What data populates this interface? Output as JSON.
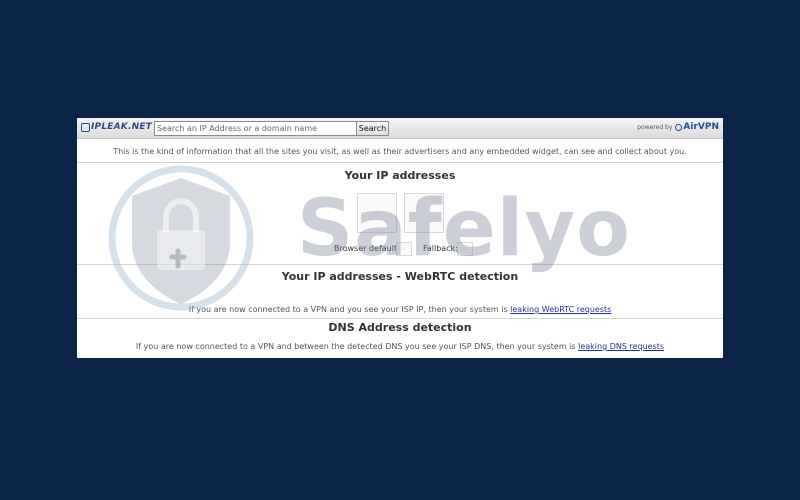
{
  "header": {
    "logo_text": "IPLEAK.NET",
    "search_placeholder": "Search an IP Address or a domain name",
    "search_button": "Search",
    "powered_by": "powered by",
    "powered_brand": "AirVPN"
  },
  "intro": "This is the kind of information that all the sites you visit, as well as their advertisers and any embedded widget, can see and collect about you.",
  "ip_section": {
    "title": "Your IP addresses",
    "box_placeholder": "…",
    "browser_default_label": "Browser default:",
    "fallback_label": "Fallback:",
    "small_box_placeholder": "…"
  },
  "webrtc_section": {
    "title": "Your IP addresses - WebRTC detection",
    "text": "If you are now connected to a VPN and you see your ISP IP, then your system is",
    "link": "leaking WebRTC requests"
  },
  "dns_section": {
    "title": "DNS Address detection",
    "text": "If you are now connected to a VPN and between the detected DNS you see your ISP DNS, then your system is",
    "link": "leaking DNS requests"
  },
  "watermark": {
    "text": "Safelyo"
  },
  "colors": {
    "background": "#0b2447",
    "link": "#2a2aa8",
    "brand": "#1f4d9a"
  }
}
